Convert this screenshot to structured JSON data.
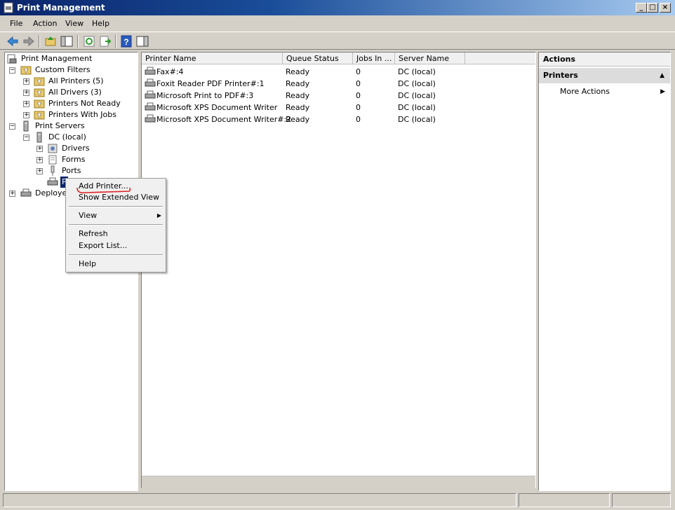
{
  "window": {
    "title": "Print Management"
  },
  "menu": {
    "items": [
      "File",
      "Action",
      "View",
      "Help"
    ]
  },
  "tree": {
    "root": "Print Management",
    "custom_filters": "Custom Filters",
    "all_printers": "All Printers (5)",
    "all_drivers": "All Drivers (3)",
    "printers_not_ready": "Printers Not Ready",
    "printers_with_jobs": "Printers With Jobs",
    "print_servers": "Print Servers",
    "dc_local": "DC (local)",
    "drivers": "Drivers",
    "forms": "Forms",
    "ports": "Ports",
    "printers_partial": "P",
    "deployed_partial": "Deployed"
  },
  "list": {
    "columns": [
      "Printer Name",
      "Queue Status",
      "Jobs In ...",
      "Server Name"
    ],
    "rows": [
      [
        "Fax#:4",
        "Ready",
        "0",
        "DC (local)"
      ],
      [
        "Foxit Reader PDF Printer#:1",
        "Ready",
        "0",
        "DC (local)"
      ],
      [
        "Microsoft Print to PDF#:3",
        "Ready",
        "0",
        "DC (local)"
      ],
      [
        "Microsoft XPS Document Writer",
        "Ready",
        "0",
        "DC (local)"
      ],
      [
        "Microsoft XPS Document Writer#:2",
        "Ready",
        "0",
        "DC (local)"
      ]
    ]
  },
  "actions": {
    "header": "Actions",
    "section": "Printers",
    "more_actions": "More Actions"
  },
  "context_menu": {
    "add_printer": "Add Printer...",
    "show_extended_view": "Show Extended View",
    "view": "View",
    "refresh": "Refresh",
    "export_list": "Export List...",
    "help": "Help"
  },
  "colors": {
    "annotation": "#e02020",
    "title_bar": "#0a246a",
    "selection": "#0a246a"
  }
}
